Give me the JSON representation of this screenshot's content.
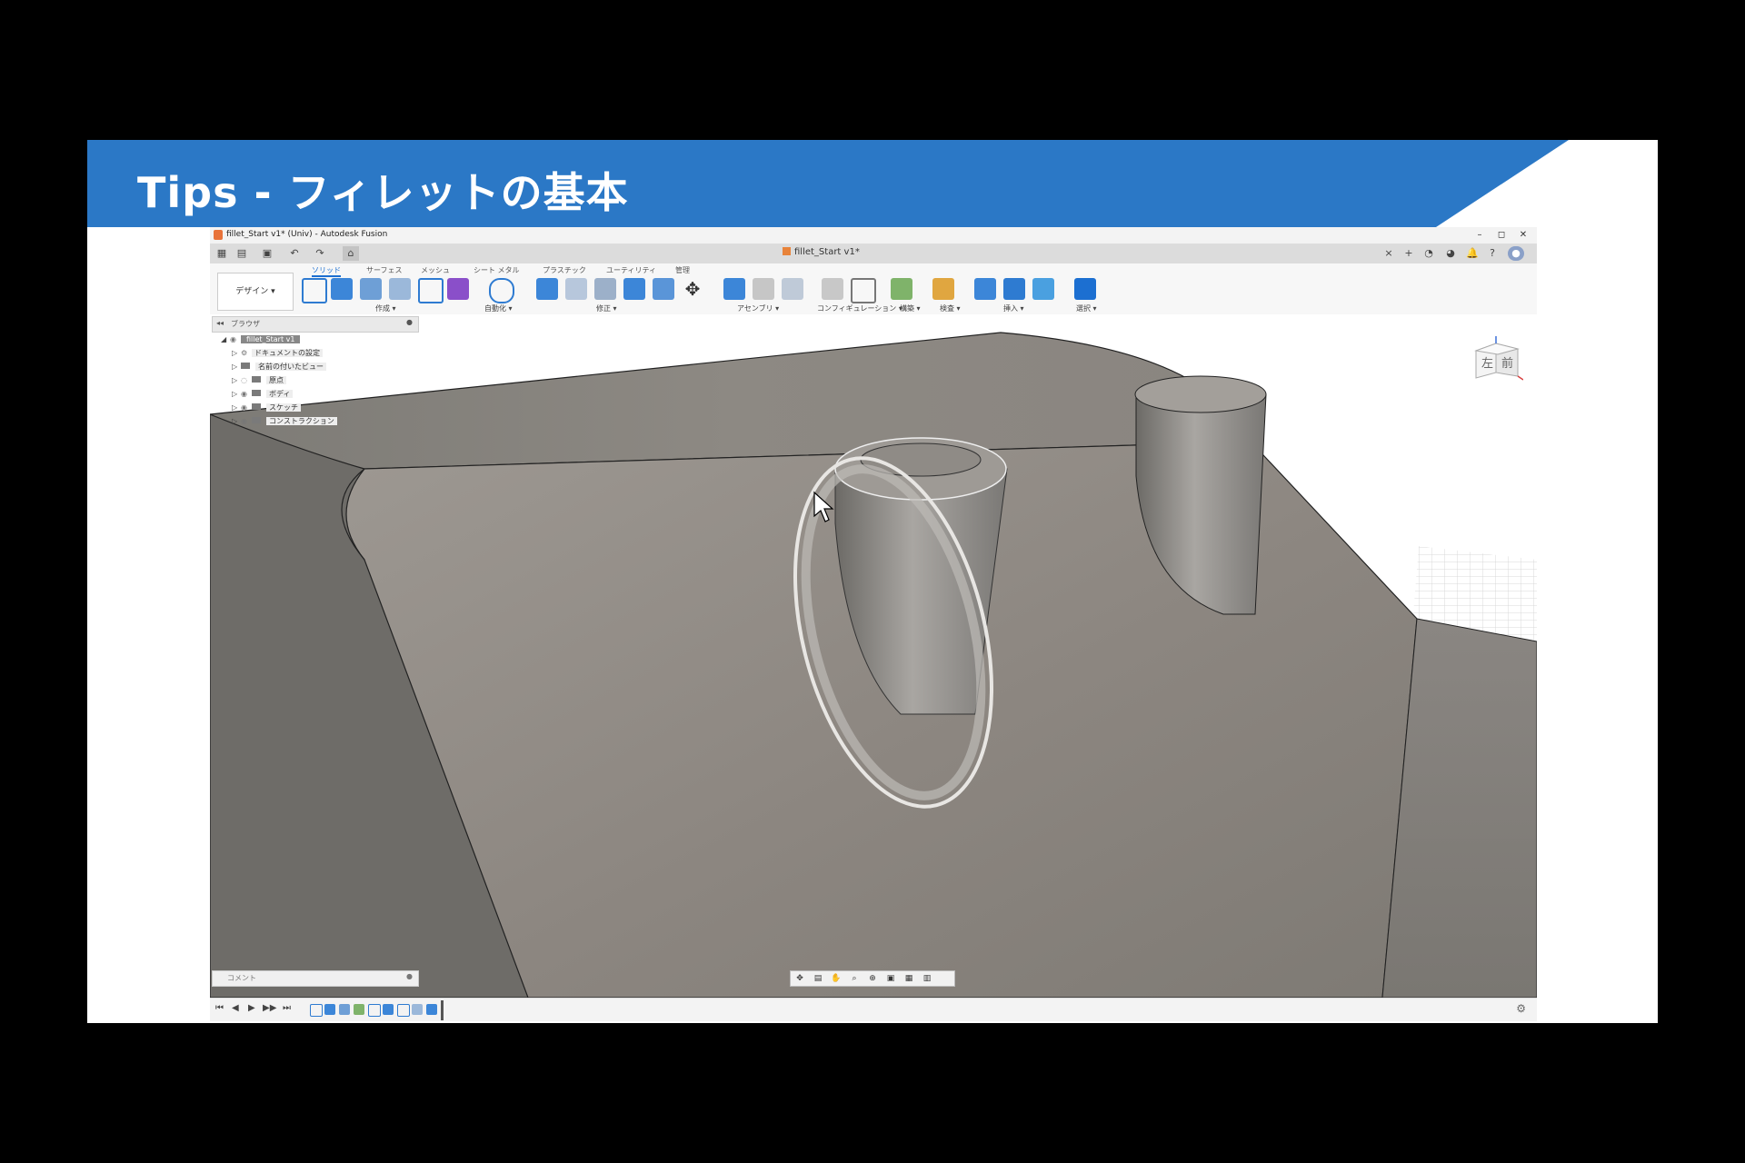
{
  "slide": {
    "title": "Tips - フィレットの基本",
    "banner_color": "#2b78c6"
  },
  "app": {
    "window_title": "fillet_Start v1* (Univ) - Autodesk Fusion",
    "doc_tab": "fillet_Start v1*",
    "window_buttons": [
      "–",
      "◻",
      "✕"
    ],
    "workspace": "デザイン ▾",
    "ribbon_tabs": [
      "ソリッド",
      "サーフェス",
      "メッシュ",
      "シート メタル",
      "プラスチック",
      "ユーティリティ",
      "管理"
    ],
    "active_tab": "ソリッド",
    "ribbon_groups": [
      "作成 ▾",
      "自動化 ▾",
      "修正 ▾",
      "アセンブリ ▾",
      "コンフィギュレーション ▾",
      "構築 ▾",
      "検査 ▾",
      "挿入 ▾",
      "選択 ▾"
    ],
    "accent_color": "#1c6fd1"
  },
  "browser": {
    "title": "ブラウザ",
    "root": "fillet_Start v1",
    "items": [
      "ドキュメントの設定",
      "名前の付いたビュー",
      "原点",
      "ボディ",
      "スケッチ",
      "コンストラクション"
    ]
  },
  "viewcube": {
    "left_face": "左",
    "front_face": "前"
  },
  "comment": {
    "label": "コメント"
  },
  "timeline": {
    "controls": [
      "⏮",
      "◀",
      "▶",
      "▶▶",
      "⏭"
    ],
    "feature_count": 9
  }
}
